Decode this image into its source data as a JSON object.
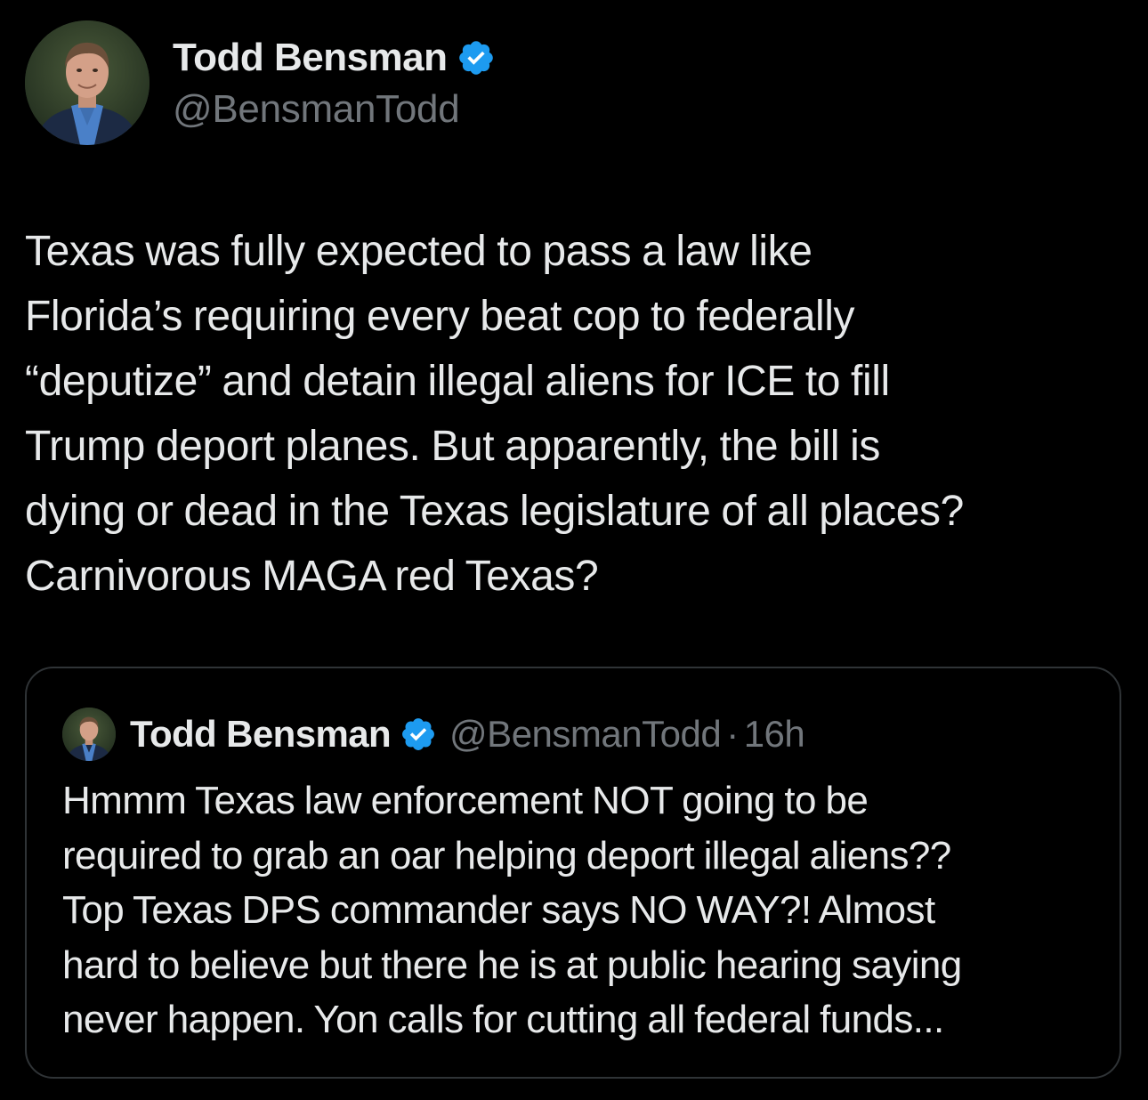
{
  "colors": {
    "background": "#000000",
    "text_primary": "#e7e9ea",
    "text_secondary": "#71767b",
    "verified_blue": "#1d9bf0",
    "card_border": "#2f3336"
  },
  "author": {
    "name": "Todd Bensman",
    "handle": "@BensmanTodd",
    "verified_icon": "verified-badge-icon"
  },
  "tweet": {
    "lines": [
      "Texas was fully expected to pass a law like",
      "Florida’s requiring every beat cop to federally",
      "“deputize” and detain illegal aliens for ICE to fill",
      "Trump deport planes. But apparently, the bill is",
      "dying or dead in the Texas legislature of all places?",
      "Carnivorous MAGA red Texas?"
    ]
  },
  "quoted_tweet": {
    "author_name": "Todd Bensman",
    "handle": "@BensmanTodd",
    "separator": "·",
    "time": "16h",
    "lines": [
      "Hmmm Texas law enforcement NOT going to be",
      "required to grab an oar helping deport illegal aliens??",
      "Top Texas DPS commander says NO WAY?! Almost",
      "hard to believe but there he is at public hearing saying",
      "never happen. Yon calls for cutting all federal funds..."
    ]
  }
}
